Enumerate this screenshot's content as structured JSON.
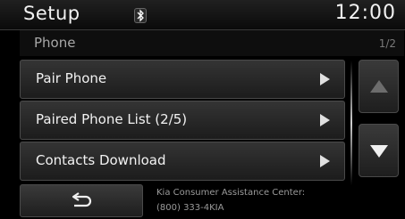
{
  "header": {
    "title": "Setup",
    "clock": "12:00",
    "bluetooth_icon": "bluetooth-icon"
  },
  "subheader": {
    "title": "Phone",
    "page": "1/2"
  },
  "menu": {
    "items": [
      {
        "label": "Pair Phone"
      },
      {
        "label": "Paired Phone List (2/5)"
      },
      {
        "label": "Contacts Download"
      }
    ]
  },
  "scroll": {
    "up_icon": "triangle-up-icon",
    "down_icon": "triangle-down-icon",
    "up_enabled": false,
    "down_enabled": true
  },
  "footer": {
    "line1": "Kia Consumer Assistance Center:",
    "line2": "(800) 333-4KIA",
    "back_icon": "back-arrow-icon"
  }
}
